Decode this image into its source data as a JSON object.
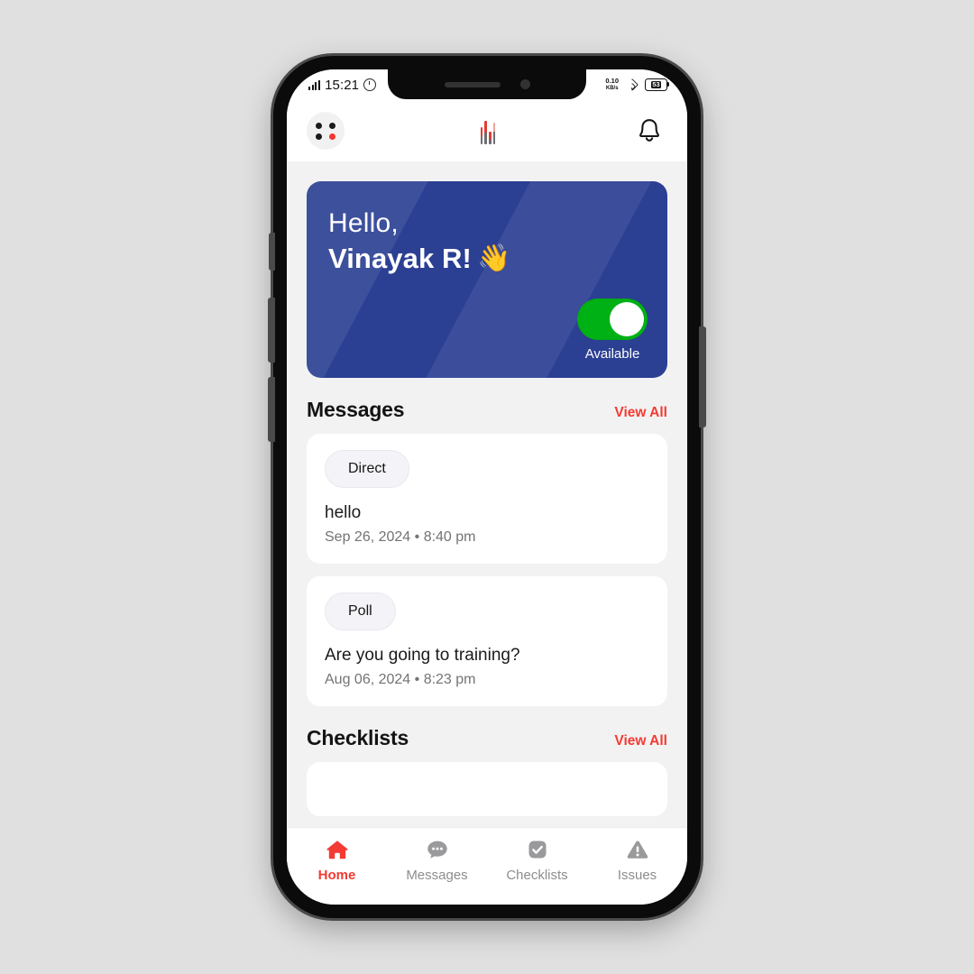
{
  "status_bar": {
    "time": "15:21",
    "signal_icon": "signal-bars-icon",
    "alarm_icon": "alarm-icon",
    "network_speed_value": "0.10",
    "network_speed_unit": "KB/s",
    "wifi_icon": "wifi-icon",
    "battery_level": "53"
  },
  "header": {
    "grid_icon": "grid-dots-icon",
    "logo_icon": "brand-bars-logo",
    "bell_icon": "bell-icon"
  },
  "hero": {
    "greeting": "Hello,",
    "name": "Vinayak R!",
    "wave_emoji": "👋",
    "availability_label": "Available",
    "availability_on": true,
    "bg_color": "#2b3f93",
    "toggle_color": "#00b115"
  },
  "sections": {
    "messages": {
      "title": "Messages",
      "view_all_label": "View All",
      "items": [
        {
          "badge": "Direct",
          "text": "hello",
          "timestamp": "Sep 26, 2024 • 8:40 pm"
        },
        {
          "badge": "Poll",
          "text": "Are you going to training?",
          "timestamp": "Aug 06, 2024 • 8:23 pm"
        }
      ]
    },
    "checklists": {
      "title": "Checklists",
      "view_all_label": "View All"
    }
  },
  "bottom_nav": {
    "active_index": 0,
    "items": [
      {
        "label": "Home",
        "icon": "home-icon"
      },
      {
        "label": "Messages",
        "icon": "chat-bubble-icon"
      },
      {
        "label": "Checklists",
        "icon": "checkbox-check-icon"
      },
      {
        "label": "Issues",
        "icon": "warning-triangle-icon"
      }
    ]
  },
  "theme": {
    "accent_red": "#f33b33",
    "brand_blue": "#2b3f93",
    "page_bg": "#f2f2f2",
    "inactive_gray": "#8d8d90"
  }
}
